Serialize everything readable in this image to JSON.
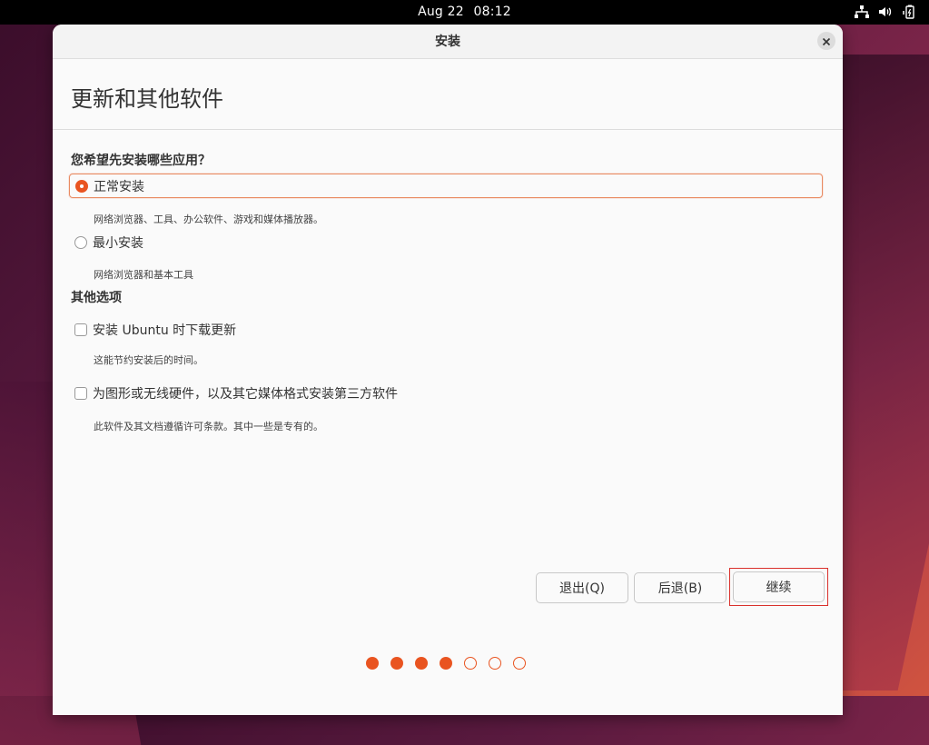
{
  "topbar": {
    "date": "Aug 22",
    "time": "08:12",
    "icons": [
      "network-icon",
      "volume-icon",
      "battery-icon"
    ]
  },
  "window": {
    "title": "安装",
    "close_icon": "close-icon"
  },
  "page": {
    "title": "更新和其他软件",
    "question": "您希望先安装哪些应用？",
    "install_options": [
      {
        "label": "正常安装",
        "description": "网络浏览器、工具、办公软件、游戏和媒体播放器。",
        "selected": true
      },
      {
        "label": "最小安装",
        "description": "网络浏览器和基本工具",
        "selected": false
      }
    ],
    "other_section": "其他选项",
    "other_options": [
      {
        "label": "安装 Ubuntu 时下载更新",
        "description": "这能节约安装后的时间。",
        "checked": false
      },
      {
        "label": "为图形或无线硬件，以及其它媒体格式安装第三方软件",
        "description": "此软件及其文档遵循许可条款。其中一些是专有的。",
        "checked": false
      }
    ]
  },
  "buttons": {
    "quit": "退出(Q)",
    "back": "后退(B)",
    "continue": "继续"
  },
  "progress": {
    "total_steps": 7,
    "completed_steps": 4
  },
  "colors": {
    "accent": "#e95420",
    "focus_border": "#d9302b"
  }
}
